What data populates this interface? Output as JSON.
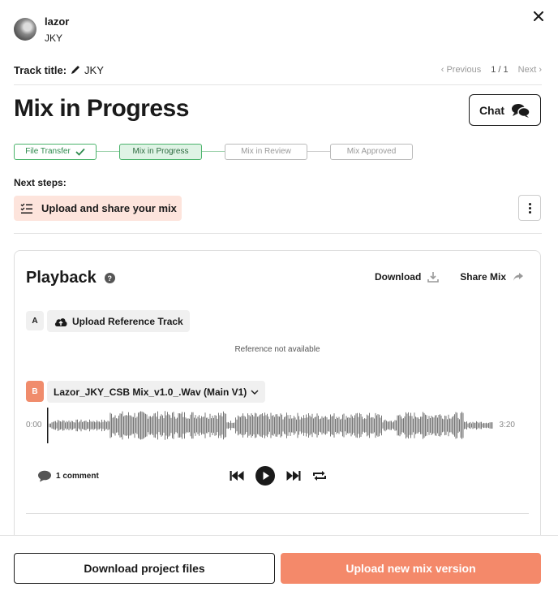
{
  "user": {
    "name": "lazor",
    "sub": "JKY"
  },
  "track": {
    "label": "Track title:",
    "value": "JKY"
  },
  "pager": {
    "previous": "Previous",
    "count": "1 / 1",
    "next": "Next"
  },
  "page_title": "Mix in Progress",
  "chat_label": "Chat",
  "steps": [
    {
      "label": "File Transfer",
      "state": "done"
    },
    {
      "label": "Mix in Progress",
      "state": "active"
    },
    {
      "label": "Mix in Review",
      "state": "todo"
    },
    {
      "label": "Mix Approved",
      "state": "todo"
    }
  ],
  "next_steps": {
    "label": "Next steps:",
    "item": "Upload and share your mix"
  },
  "playback": {
    "title": "Playback",
    "help": "?",
    "download_label": "Download",
    "share_label": "Share Mix",
    "ref_badge": "A",
    "upload_ref_label": "Upload Reference Track",
    "ref_unavailable": "Reference not available",
    "mix_badge": "B",
    "mix_file": "Lazor_JKY_CSB Mix_v1.0_.Wav (Main V1)",
    "time_start": "0:00",
    "time_end": "3:20",
    "comments": "1 comment",
    "progress": 0
  },
  "footer": {
    "download_project": "Download project files",
    "upload_new": "Upload new mix version"
  },
  "colors": {
    "accent": "#f4896a",
    "success": "#4ab36a",
    "success_bg": "#dff3e5",
    "next_bg": "#fde4dc"
  }
}
